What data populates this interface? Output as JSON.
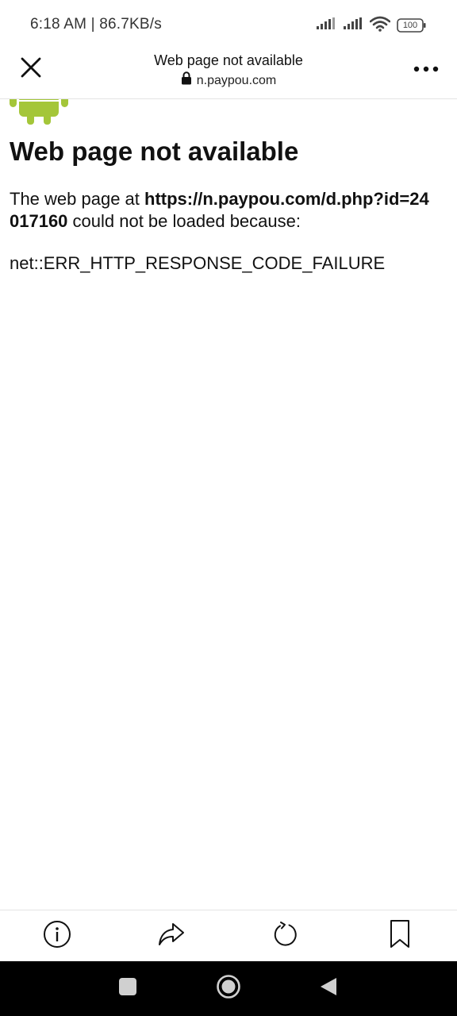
{
  "status_bar": {
    "time_speed": "6:18 AM | 86.7KB/s",
    "battery": "100",
    "icons": [
      "signal-icon",
      "signal-icon",
      "wifi-icon",
      "battery-icon"
    ]
  },
  "app_bar": {
    "title": "Web page not available",
    "url": "n.paypou.com",
    "icons": [
      "close-icon",
      "lock-icon",
      "more-icon"
    ]
  },
  "content": {
    "heading": "Web page not available",
    "message_prefix": "The web page at ",
    "message_url": "https://n.paypou.com/d.php?id=24017160",
    "message_suffix": " could not be loaded because:",
    "error_code": "net::ERR_HTTP_RESPONSE_CODE_FAILURE",
    "illustration": "android-robot"
  },
  "bottom_toolbar": {
    "icons": [
      "info-icon",
      "share-icon",
      "refresh-icon",
      "bookmark-icon"
    ]
  },
  "nav_bar": {
    "icons": [
      "recents-icon",
      "home-icon",
      "back-icon"
    ]
  },
  "colors": {
    "android_green": "#a4c639",
    "nav_bar_bg": "#000000",
    "nav_icon": "#d0d0d0",
    "divider": "#e3e3e3",
    "text": "#111111"
  }
}
